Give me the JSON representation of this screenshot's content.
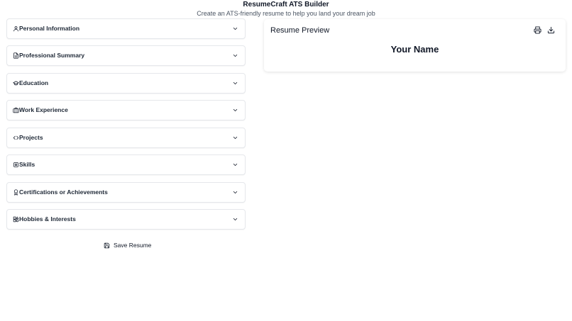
{
  "header": {
    "title": "ResumeCraft ATS Builder",
    "subtitle": "Create an ATS-friendly resume to help you land your dream job"
  },
  "sections": [
    {
      "label": "Personal Information",
      "icon": "user-icon"
    },
    {
      "label": "Professional Summary",
      "icon": "file-text-icon"
    },
    {
      "label": "Education",
      "icon": "graduation-cap-icon"
    },
    {
      "label": "Work Experience",
      "icon": "briefcase-icon"
    },
    {
      "label": "Projects",
      "icon": "code-icon"
    },
    {
      "label": "Skills",
      "icon": "cpu-icon"
    },
    {
      "label": "Certifications or Achievements",
      "icon": "award-icon"
    },
    {
      "label": "Hobbies & Interests",
      "icon": "shapes-icon"
    }
  ],
  "save": {
    "label": "Save Resume",
    "icon": "save-icon"
  },
  "preview": {
    "title": "Resume Preview",
    "name": "Your Name",
    "actions": [
      "printer-icon",
      "download-icon"
    ]
  },
  "colors": {
    "border": "#e5e7eb",
    "text": "#111827",
    "muted": "#4b5563"
  }
}
